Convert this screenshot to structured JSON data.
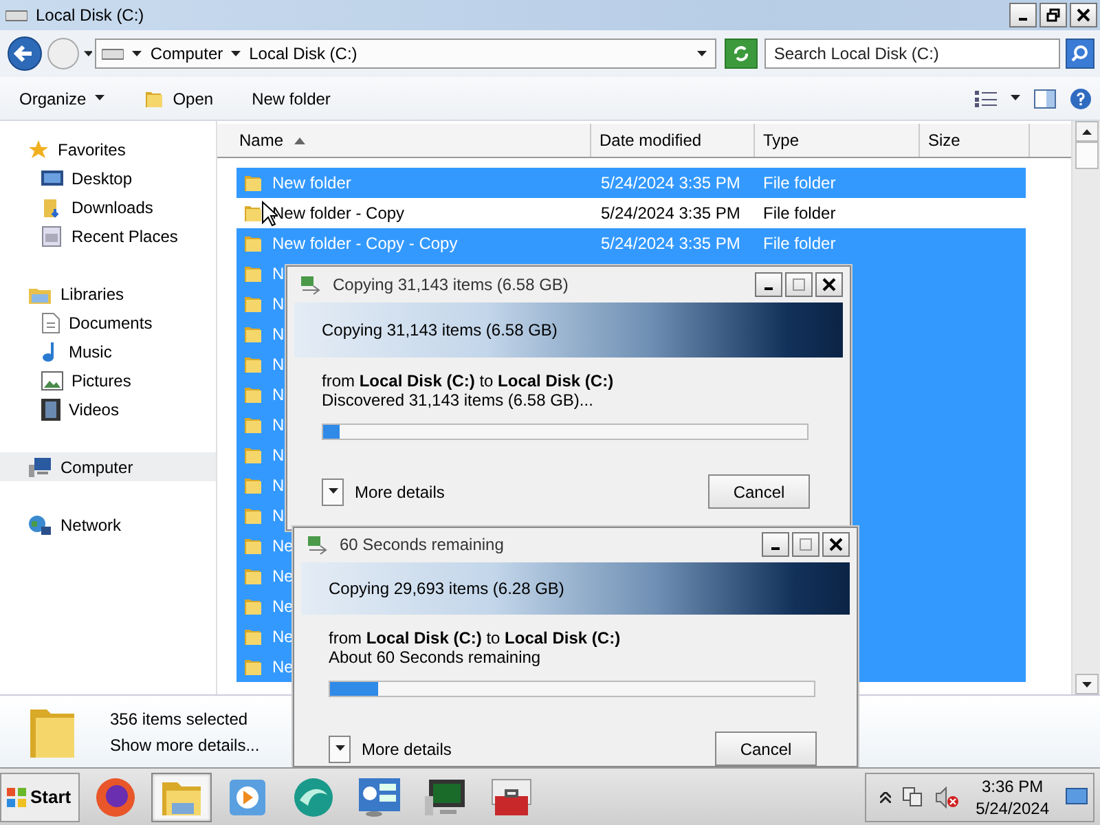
{
  "window": {
    "title": "Local Disk (C:)"
  },
  "address_bar": {
    "breadcrumbs": [
      "Computer",
      "Local Disk (C:)"
    ],
    "search": {
      "placeholder": "Search Local Disk (C:)"
    }
  },
  "toolbar": {
    "buttons": [
      {
        "label": "Organize",
        "kind": "menu"
      },
      {
        "label": "Open",
        "kind": "icon"
      },
      {
        "label": "New folder",
        "kind": "plain"
      }
    ]
  },
  "sidebar": {
    "groups": [
      {
        "label": "Favorites",
        "selected": false,
        "children": [
          {
            "label": "Desktop",
            "selected": false
          },
          {
            "label": "Downloads",
            "selected": false
          },
          {
            "label": "Recent Places",
            "selected": false
          }
        ]
      },
      {
        "label": "Libraries",
        "selected": false,
        "children": [
          {
            "label": "Documents",
            "selected": false
          },
          {
            "label": "Music",
            "selected": false
          },
          {
            "label": "Pictures",
            "selected": false
          },
          {
            "label": "Videos",
            "selected": false
          }
        ]
      },
      {
        "label": "Computer",
        "selected": true
      },
      {
        "label": "Network",
        "selected": false
      }
    ]
  },
  "file_list": {
    "columns": [
      {
        "label": "Name",
        "sorted": true
      },
      {
        "label": "Date modified",
        "sorted": false
      },
      {
        "label": "Type",
        "sorted": false
      },
      {
        "label": "Size",
        "sorted": false
      }
    ],
    "rows": [
      {
        "name": "New folder",
        "date_modified": "5/24/2024 3:35 PM",
        "type": "File folder",
        "selected": true
      },
      {
        "name": "New folder - Copy",
        "date_modified": "5/24/2024 3:35 PM",
        "type": "File folder",
        "selected": false
      },
      {
        "name": "New folder - Copy - Copy",
        "date_modified": "5/24/2024 3:35 PM",
        "type": "File folder",
        "selected": true
      },
      {
        "name": "N",
        "selected": true
      },
      {
        "name": "N",
        "selected": true
      },
      {
        "name": "N",
        "selected": true
      },
      {
        "name": "N",
        "selected": true
      },
      {
        "name": "N",
        "selected": true
      },
      {
        "name": "N",
        "selected": true
      },
      {
        "name": "N",
        "selected": true
      },
      {
        "name": "N",
        "selected": true
      },
      {
        "name": "N",
        "selected": true
      },
      {
        "name": "Ne",
        "selected": true
      },
      {
        "name": "Ne",
        "selected": true
      },
      {
        "name": "Ne",
        "selected": true
      },
      {
        "name": "Ne",
        "selected": true
      },
      {
        "name": "Ne",
        "selected": true
      }
    ]
  },
  "details_pane": {
    "title": "356 items selected",
    "link": "Show more details..."
  },
  "dialogs": [
    {
      "title": "Copying 31,143 items (6.58 GB)",
      "header": "Copying 31,143 items (6.58 GB)",
      "route": "from **Local Disk (C:)** to **Local Disk (C:)**",
      "status": "Discovered 31,143 items (6.58 GB)...",
      "progress": {
        "level": 0.035
      },
      "details_button": "More details",
      "cancel_button": "Cancel"
    },
    {
      "title": "60 Seconds remaining",
      "header": "Copying 29,693 items (6.28 GB)",
      "route": "from **Local Disk (C:)** to **Local Disk (C:)**",
      "status": "About 60 Seconds remaining",
      "progress": {
        "level": 0.1
      },
      "details_button": "More details",
      "cancel_button": "Cancel"
    }
  ],
  "taskbar": {
    "start": "Start",
    "apps": [
      {
        "selected": false
      },
      {
        "selected": true
      },
      {
        "selected": false
      },
      {
        "selected": false
      },
      {
        "selected": false
      },
      {
        "selected": false
      },
      {
        "selected": false
      }
    ],
    "clock": {
      "time": "3:36 PM",
      "date": "5/24/2024"
    }
  }
}
